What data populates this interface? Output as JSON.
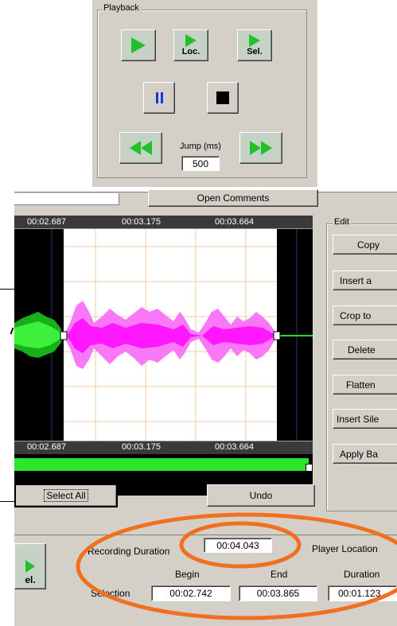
{
  "playback": {
    "title": "Playback",
    "loc_label": "Loc.",
    "sel_label": "Sel.",
    "jump_label": "Jump (ms)",
    "jump_value": "500"
  },
  "comments": {
    "open_label": "Open Comments"
  },
  "waveform": {
    "top_times": [
      "00:02.687",
      "00:03.175",
      "00:03.664"
    ],
    "bottom_times": [
      "00:02.687",
      "00:03.175",
      "00:03.664"
    ],
    "colors": {
      "background": "#000000",
      "selection": "#ffffff",
      "wave_outside": "#1ee01e",
      "wave_selected": "#ff1aff",
      "grid": "#f0c8a0"
    }
  },
  "edit": {
    "title": "Edit",
    "buttons": [
      "Copy",
      "Insert a",
      "Crop to",
      "Delete",
      "Flatten",
      "Insert Sile",
      "Apply Ba"
    ]
  },
  "actions": {
    "select_all": "Select All",
    "undo": "Undo"
  },
  "info": {
    "recording_duration_label": "Recording Duration",
    "recording_duration_value": "00:04.043",
    "player_location_label": "Player Location",
    "begin_label": "Begin",
    "end_label": "End",
    "duration_label": "Duration",
    "selection_label": "Selection",
    "begin_value": "00:02.742",
    "end_value": "00:03.865",
    "duration_value": "00:01.123"
  },
  "left_partial": {
    "sel_label": "el."
  },
  "accent_color": "#f07020"
}
